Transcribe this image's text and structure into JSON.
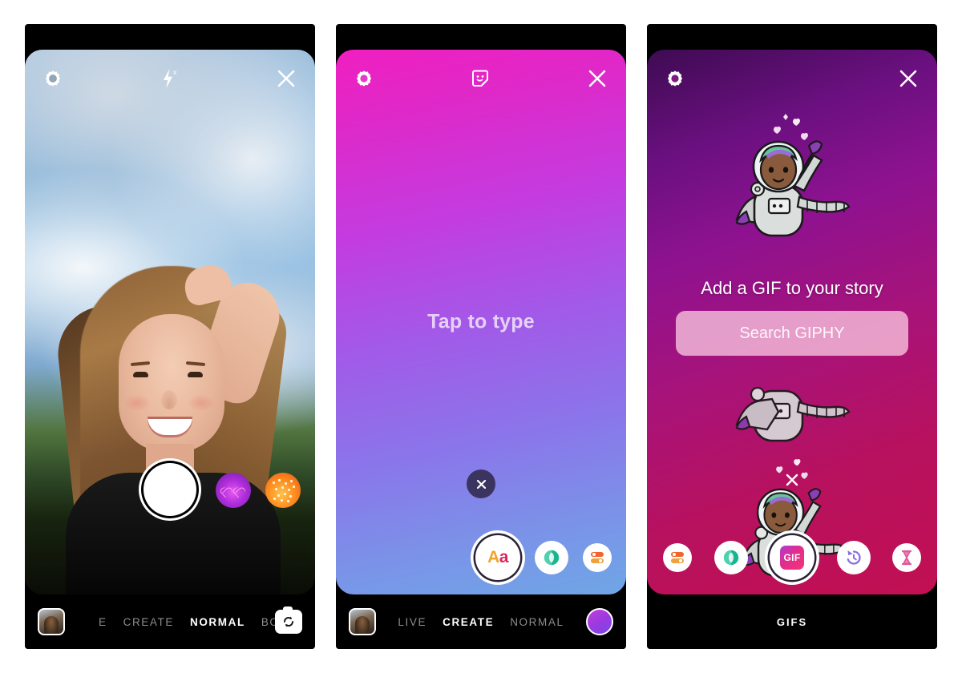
{
  "screens": [
    {
      "id": "camera",
      "topbar": {
        "settings_icon": "gear-icon",
        "flash_icon": "flash-off-icon",
        "close_icon": "close-icon"
      },
      "filters": [
        {
          "name": "heart-glasses-filter",
          "color": "#b02ddb"
        },
        {
          "name": "confetti-filter",
          "color": "#ff8a1f"
        }
      ],
      "shutter_label": "",
      "modebar": {
        "thumbnail": "gallery-thumbnail",
        "modes": [
          {
            "label": "E",
            "active": false
          },
          {
            "label": "CREATE",
            "active": false
          },
          {
            "label": "NORMAL",
            "active": true
          },
          {
            "label": "BOOMERAN",
            "active": false
          }
        ],
        "flip_icon": "camera-flip-icon"
      }
    },
    {
      "id": "create-text",
      "topbar": {
        "settings_icon": "gear-icon",
        "sticker_icon": "sticker-face-icon",
        "close_icon": "close-icon"
      },
      "canvas": {
        "placeholder": "Tap to type",
        "dismiss_icon": "close-icon"
      },
      "tools": [
        {
          "name": "text-tool",
          "label": "Aa",
          "selected": true
        },
        {
          "name": "color-picker-tool",
          "label": "",
          "selected": false
        },
        {
          "name": "effects-tool",
          "label": "",
          "selected": false
        }
      ],
      "modebar": {
        "thumbnail": "gallery-thumbnail",
        "modes": [
          {
            "label": "LIVE",
            "active": false
          },
          {
            "label": "CREATE",
            "active": true
          },
          {
            "label": "NORMAL",
            "active": false
          }
        ],
        "avatar": "gradient-avatar"
      }
    },
    {
      "id": "gif",
      "topbar": {
        "settings_icon": "gear-icon",
        "close_icon": "close-icon"
      },
      "canvas": {
        "headline": "Add a GIF to your story",
        "search_button": "Search GIPHY",
        "dismiss_icon": "close-icon",
        "sticker": "astronaut-hearts-gif"
      },
      "tools": [
        {
          "name": "effects-tool",
          "label": "",
          "selected": false
        },
        {
          "name": "color-picker-tool",
          "label": "",
          "selected": false
        },
        {
          "name": "gif-tool",
          "label": "GIF",
          "selected": true
        },
        {
          "name": "rewind-tool",
          "label": "",
          "selected": false
        },
        {
          "name": "timer-tool",
          "label": "",
          "selected": false
        }
      ],
      "modebar": {
        "label": "GIFS"
      }
    }
  ],
  "theme": {
    "page_bg": "#ffffff",
    "phone_bg": "#000000",
    "accent_pink": "#e12d8c",
    "accent_purple": "#b02ddb"
  }
}
